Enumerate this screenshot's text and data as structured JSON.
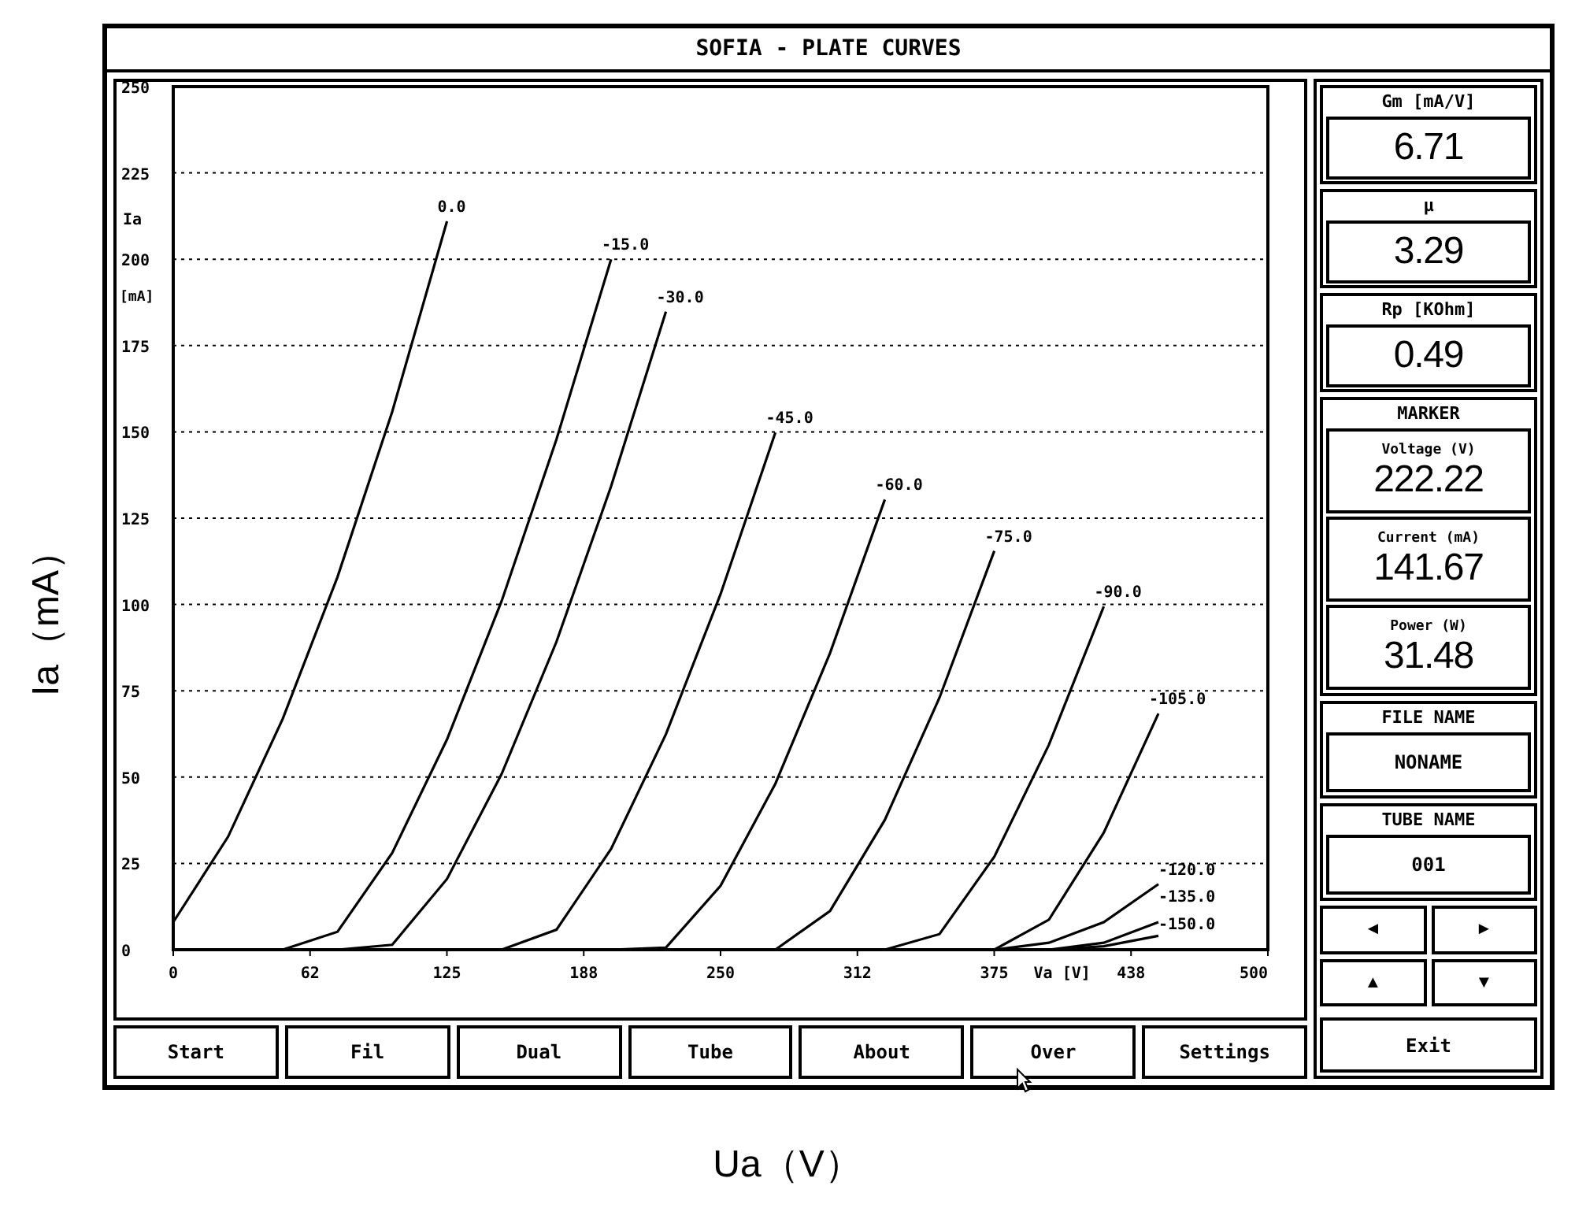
{
  "window": {
    "title": "SOFIA - PLATE CURVES"
  },
  "chart": {
    "chart_data": {
      "type": "line",
      "grid": true,
      "xlabel": "Va [V]",
      "ylabel": "Ia",
      "xlim": [
        0,
        500
      ],
      "ylim": [
        0,
        250
      ],
      "xticks": [
        0,
        {
          "value": 62.5,
          "label": "62"
        },
        125,
        {
          "value": 187.5,
          "label": "188"
        },
        250,
        {
          "value": 312.5,
          "label": "312"
        },
        375,
        {
          "value": 437.5,
          "label": "438"
        },
        500
      ],
      "yticks": [
        0,
        25,
        50,
        75,
        100,
        125,
        150,
        175,
        200,
        225,
        250
      ],
      "x": [
        0,
        25,
        50,
        75,
        100,
        125,
        150,
        175,
        200,
        225,
        250,
        275,
        300,
        325,
        350,
        375,
        400,
        425,
        450
      ],
      "series": [
        {
          "name": "0.0",
          "values": [
            8,
            32.7,
            66.9,
            108,
            155.8,
            211,
            null,
            null,
            null,
            null,
            null,
            null,
            null,
            null,
            null,
            null,
            null,
            null,
            null
          ]
        },
        {
          "name": "-15.0",
          "values": [
            null,
            null,
            0,
            5.2,
            28,
            60.9,
            101,
            147.8,
            200,
            null,
            null,
            null,
            null,
            null,
            null,
            null,
            null,
            null,
            null
          ]
        },
        {
          "name": "-30.0",
          "values": [
            null,
            null,
            null,
            0,
            1.4,
            20.5,
            50.9,
            89.2,
            134.2,
            184.8,
            null,
            null,
            null,
            null,
            null,
            null,
            null,
            null,
            null
          ]
        },
        {
          "name": "-45.0",
          "values": [
            null,
            null,
            null,
            null,
            null,
            null,
            0,
            5.8,
            29.2,
            62.4,
            103,
            149.8,
            null,
            null,
            null,
            null,
            null,
            null,
            null
          ]
        },
        {
          "name": "-60.0",
          "values": [
            null,
            null,
            null,
            null,
            null,
            null,
            null,
            null,
            0,
            0.6,
            18.5,
            48.1,
            85.9,
            130.4,
            null,
            null,
            null,
            null,
            null
          ]
        },
        {
          "name": "-75.0",
          "values": [
            null,
            null,
            null,
            null,
            null,
            null,
            null,
            null,
            null,
            null,
            null,
            0,
            11.2,
            37.6,
            73,
            115.5,
            null,
            null,
            null
          ]
        },
        {
          "name": "-90.0",
          "values": [
            null,
            null,
            null,
            null,
            null,
            null,
            null,
            null,
            null,
            null,
            null,
            null,
            null,
            0,
            4.5,
            26.9,
            59.4,
            99.4,
            null
          ]
        },
        {
          "name": "-105.0",
          "values": [
            null,
            null,
            null,
            null,
            null,
            null,
            null,
            null,
            null,
            null,
            null,
            null,
            null,
            null,
            null,
            0,
            8.7,
            33.9,
            68.4
          ]
        },
        {
          "name": "-120.0",
          "values": [
            null,
            null,
            null,
            null,
            null,
            null,
            null,
            null,
            null,
            null,
            null,
            null,
            null,
            null,
            null,
            0,
            2,
            8,
            19
          ]
        },
        {
          "name": "-135.0",
          "values": [
            null,
            null,
            null,
            null,
            null,
            null,
            null,
            null,
            null,
            null,
            null,
            null,
            null,
            null,
            null,
            null,
            0,
            2,
            8
          ]
        },
        {
          "name": "-150.0",
          "values": [
            null,
            null,
            null,
            null,
            null,
            null,
            null,
            null,
            null,
            null,
            null,
            null,
            null,
            null,
            null,
            null,
            0,
            1,
            4
          ]
        }
      ]
    },
    "y_unit": "[mA]"
  },
  "buttons": [
    "Start",
    "Fil",
    "Dual",
    "Tube",
    "About",
    "Over",
    "Settings"
  ],
  "readouts": [
    {
      "label": "Gm [mA/V]",
      "value": "6.71"
    },
    {
      "label": "μ",
      "value": "3.29"
    },
    {
      "label": "Rp [KOhm]",
      "value": "0.49"
    }
  ],
  "marker": {
    "title": "MARKER",
    "fields": [
      {
        "label": "Voltage (V)",
        "value": "222.22"
      },
      {
        "label": "Current (mA)",
        "value": "141.67"
      },
      {
        "label": "Power (W)",
        "value": "31.48"
      }
    ]
  },
  "file_name": {
    "label": "FILE NAME",
    "value": "NONAME"
  },
  "tube_name": {
    "label": "TUBE NAME",
    "value": "001"
  },
  "nav_buttons": [
    "◄",
    "►",
    "▲",
    "▼"
  ],
  "exit_button": "Exit",
  "figure_labels": {
    "y_axis": "Ia（mA）",
    "x_axis": "Ua（V）"
  }
}
